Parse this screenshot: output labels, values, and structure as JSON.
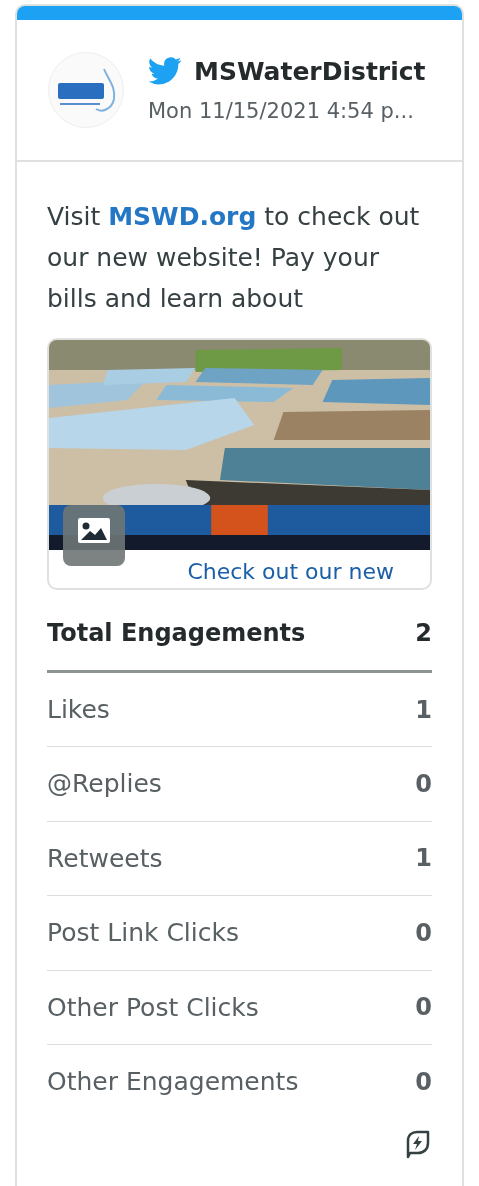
{
  "account": {
    "name": "MSWaterDistrict",
    "date": "Mon 11/15/2021 4:54 p..."
  },
  "post": {
    "text": "Visit **MSWD.org** to check out our new website! Pay your bills and learn about",
    "preview": {
      "kind": "picture",
      "title": "Check out our new"
    }
  },
  "total": {
    "label": "Total Engagements",
    "value": "2"
  },
  "metrics": [
    {
      "label": "Likes",
      "value": "1"
    },
    {
      "label": "@Replies",
      "value": "0"
    },
    {
      "label": "Retweets",
      "value": "1"
    },
    {
      "label": "Post Link Clicks",
      "value": "0"
    },
    {
      "label": "Other Post Clicks",
      "value": "0"
    },
    {
      "label": "Other Engagements",
      "value": "0"
    }
  ]
}
